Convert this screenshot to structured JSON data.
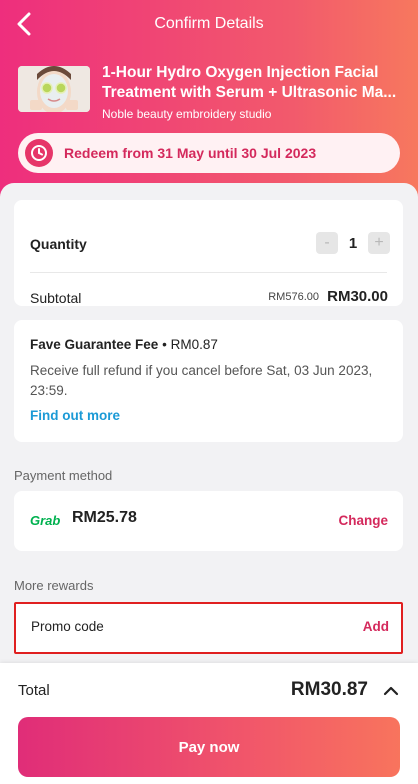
{
  "header": {
    "title": "Confirm Details",
    "deal_title_line1": "1-Hour Hydro Oxygen Injection Facial",
    "deal_title_line2": "Treatment with Serum + Ultrasonic Ma...",
    "merchant": "Noble beauty embroidery studio",
    "redeem_text": "Redeem from 31 May until 30 Jul 2023"
  },
  "quantity": {
    "label": "Quantity",
    "value": "1",
    "minus": "-",
    "plus": "+"
  },
  "subtotal": {
    "label": "Subtotal",
    "original": "RM576.00",
    "price": "RM30.00"
  },
  "fee": {
    "title": "Fave Guarantee Fee",
    "bullet": "•",
    "amount": "RM0.87",
    "description": "Receive full refund if you cancel before Sat, 03 Jun 2023, 23:59.",
    "link": "Find out more"
  },
  "payment": {
    "section_label": "Payment method",
    "provider": "Grab",
    "amount": "RM25.78",
    "change": "Change"
  },
  "rewards": {
    "section_label": "More rewards",
    "promo_label": "Promo code",
    "promo_action": "Add"
  },
  "footer": {
    "total_label": "Total",
    "total_amount": "RM30.87",
    "pay_button": "Pay now"
  },
  "colors": {
    "brand_pink": "#e63569",
    "link_blue": "#1b9ad6",
    "grab_green": "#00b14f",
    "highlight_red": "#e02020"
  },
  "icons": {
    "back": "chevron-left-icon",
    "clock": "clock-icon",
    "caret": "chevron-up-icon"
  }
}
